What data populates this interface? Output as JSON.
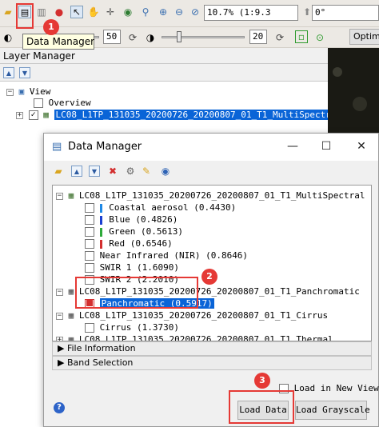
{
  "toolbar": {
    "zoom_value": "10.7% (1:9.3",
    "rotation_value": "0°",
    "tooltip": "Data Manager",
    "brightness_value": "50",
    "contrast_value": "20",
    "optimize_label": "Optimi"
  },
  "layer_manager": {
    "title": "Layer Manager",
    "tree": {
      "view_label": "View",
      "overview_label": "Overview",
      "layer_label": "LC08_L1TP_131035_20200726_20200807_01_T1_MultiSpectral"
    }
  },
  "data_manager": {
    "title": "Data Manager",
    "datasets": [
      {
        "name": "LC08_L1TP_131035_20200726_20200807_01_T1_MultiSpectral",
        "bands": [
          {
            "label": "Coastal aerosol (0.4430)",
            "color": "#1e88e5"
          },
          {
            "label": "Blue (0.4826)",
            "color": "#1a3fd1"
          },
          {
            "label": "Green (0.5613)",
            "color": "#2eaa3a"
          },
          {
            "label": "Red (0.6546)",
            "color": "#d32f2f"
          },
          {
            "label": "Near Infrared (NIR) (0.8646)",
            "color": ""
          },
          {
            "label": "SWIR 1 (1.6090)",
            "color": ""
          },
          {
            "label": "SWIR 2 (2.2010)",
            "color": ""
          }
        ]
      },
      {
        "name": "LC08_L1TP_131035_20200726_20200807_01_T1_Panchromatic",
        "bands": [
          {
            "label": "Panchromatic (0.5917)",
            "color": "#d32f2f"
          }
        ]
      },
      {
        "name": "LC08_L1TP_131035_20200726_20200807_01_T1_Cirrus",
        "bands": [
          {
            "label": "Cirrus (1.3730)",
            "color": ""
          }
        ]
      },
      {
        "name": "LC08_L1TP_131035_20200726_20200807_01_T1_Thermal",
        "bands": []
      }
    ],
    "sections": {
      "file_information": "File Information",
      "band_selection": "Band Selection"
    },
    "load_in_new_view": "Load in New View",
    "load_data": "Load Data",
    "load_grayscale": "Load Grayscale"
  },
  "annotations": {
    "badge1": "1",
    "badge2": "2",
    "badge3": "3",
    "accent": "#e53935"
  },
  "icons": [
    "open-folder-icon",
    "data-manager-icon",
    "pin-icon",
    "cursor-icon",
    "pan-icon",
    "zoom-in-icon",
    "zoom-out-icon",
    "globe-icon",
    "expand-icon",
    "collapse-icon",
    "close-x-icon",
    "options-icon",
    "edit-icon",
    "help-icon"
  ]
}
